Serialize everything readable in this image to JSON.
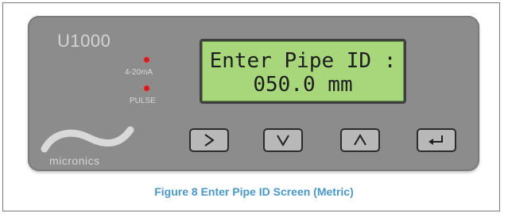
{
  "device": {
    "model": "U1000",
    "leds": [
      {
        "label": "4-20mA",
        "color": "#d51d1d"
      },
      {
        "label": "PULSE",
        "color": "#d51d1d"
      }
    ],
    "brand": "micronics",
    "display": {
      "line1": "Enter Pipe ID :",
      "line2": "050.0 mm"
    },
    "keys": [
      {
        "name": "right-arrow",
        "glyph": ">"
      },
      {
        "name": "down-arrow",
        "glyph": "V"
      },
      {
        "name": "up-arrow",
        "glyph": "Λ"
      },
      {
        "name": "enter",
        "glyph": "↵"
      }
    ]
  },
  "caption": "Figure 8 Enter Pipe ID Screen (Metric)",
  "colors": {
    "lcd": "#a8d67a",
    "panel": "#8c8c8c",
    "caption": "#4a97c9",
    "led": "#d51d1d"
  }
}
